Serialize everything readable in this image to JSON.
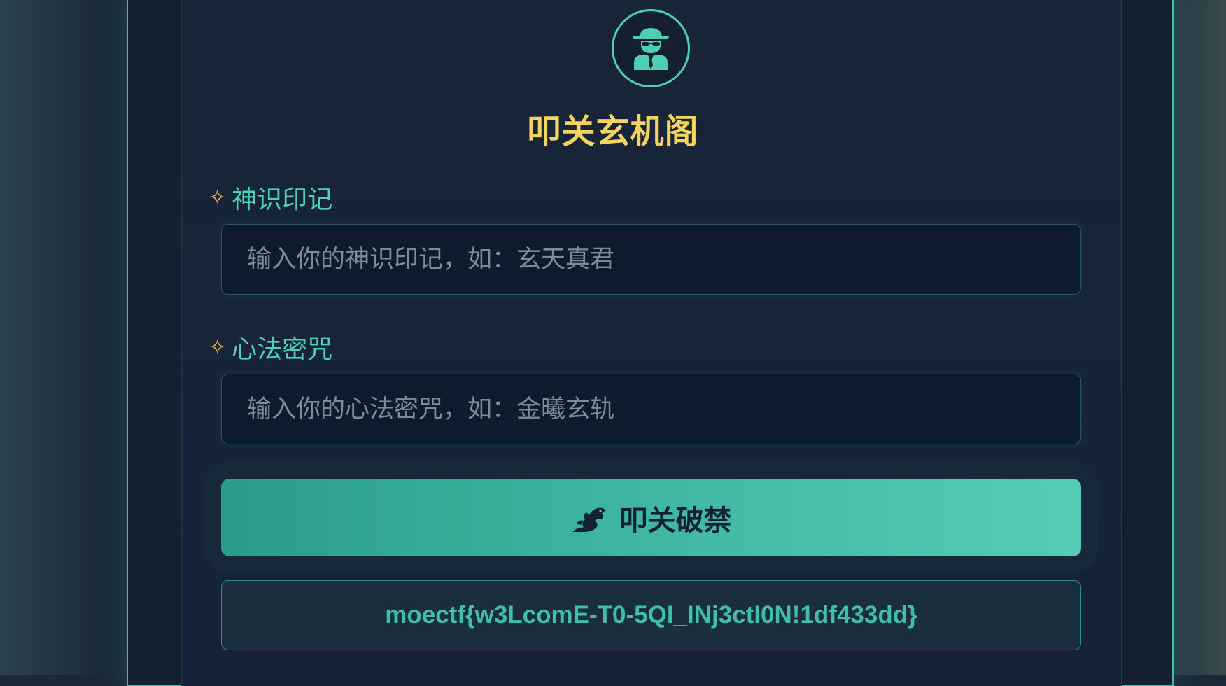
{
  "app": {
    "title": "叩关玄机阁",
    "avatar_icon": "spy-icon"
  },
  "form": {
    "username": {
      "label": "神识印记",
      "marker": "✧",
      "placeholder": "输入你的神识印记，如：玄天真君",
      "value": ""
    },
    "password": {
      "label": "心法密咒",
      "marker": "✧",
      "placeholder": "输入你的心法密咒，如：金曦玄轨",
      "value": ""
    },
    "submit": {
      "label": "叩关破禁",
      "icon": "dragon-icon"
    }
  },
  "result": {
    "flag": "moectf{w3LcomE-T0-5QI_INj3ctI0N!1df433dd}"
  },
  "colors": {
    "accent": "#3fbfa3",
    "title": "#f4d35e",
    "label": "#4fd1b5",
    "marker": "#e8b84a",
    "background": "#17223a"
  }
}
